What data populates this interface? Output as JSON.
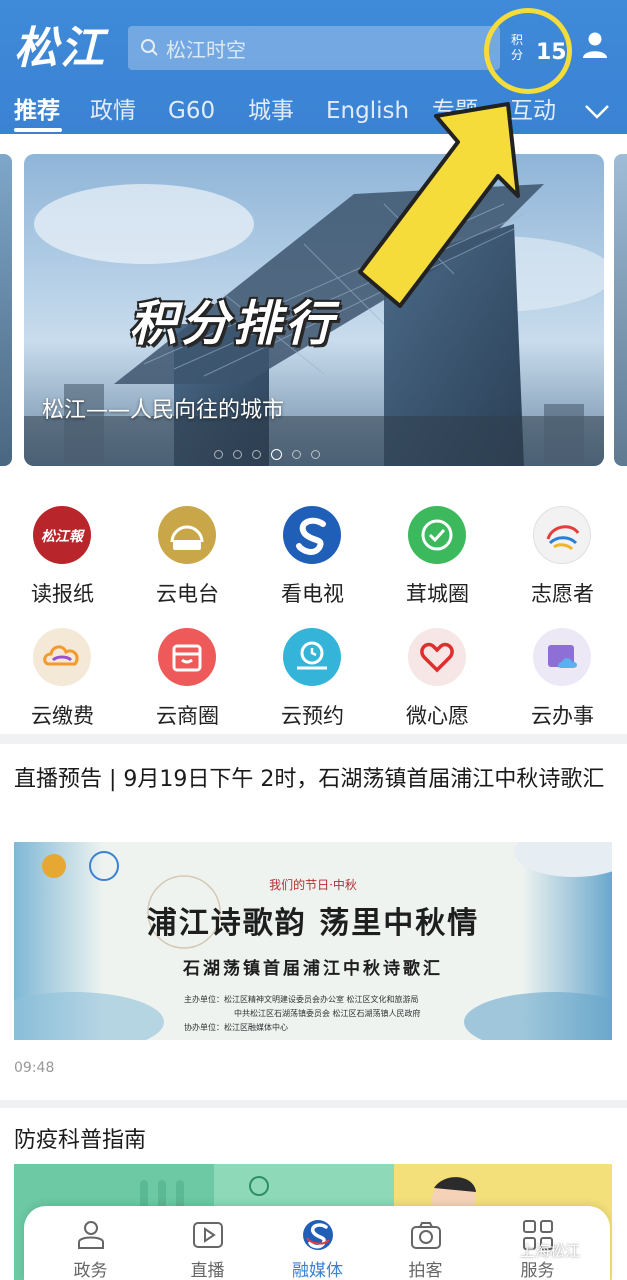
{
  "header": {
    "logo_text": "松江",
    "search_placeholder": "松江时空",
    "points_label": "积分",
    "points_value": "15"
  },
  "tabs": [
    {
      "label": "推荐"
    },
    {
      "label": "政情"
    },
    {
      "label": "G60"
    },
    {
      "label": "城事"
    },
    {
      "label": "English"
    },
    {
      "label": "专题"
    },
    {
      "label": "互动"
    }
  ],
  "banner": {
    "overlay_text": "积分排行",
    "caption": "松江——人民向往的城市",
    "slide_count": 6,
    "active_slide": 4
  },
  "services": [
    {
      "label": "读报纸",
      "icon": "newspaper-icon",
      "color": "#b8262b"
    },
    {
      "label": "云电台",
      "icon": "radio-icon",
      "color": "#c9a648"
    },
    {
      "label": "看电视",
      "icon": "tv-icon",
      "color": "#1f5fb8"
    },
    {
      "label": "茸城圈",
      "icon": "check-badge-icon",
      "color": "#3cb95c"
    },
    {
      "label": "志愿者",
      "icon": "volunteer-icon",
      "color": "#f2f2f2"
    },
    {
      "label": "云缴费",
      "icon": "cloud-pay-icon",
      "color": "#f4e8d6"
    },
    {
      "label": "云商圈",
      "icon": "shop-icon",
      "color": "#ee5a5a"
    },
    {
      "label": "云预约",
      "icon": "appointment-icon",
      "color": "#34b4d8"
    },
    {
      "label": "微心愿",
      "icon": "heart-icon",
      "color": "#f7e6e6"
    },
    {
      "label": "云办事",
      "icon": "cloud-office-icon",
      "color": "#ece8f6"
    }
  ],
  "news": [
    {
      "title": "直播预告 | 9月19日下午 2时，石湖荡镇首届浦江中秋诗歌汇",
      "time": "09:48",
      "poster": {
        "kicker": "我们的节日·中秋",
        "headline": "浦江诗歌韵 荡里中秋情",
        "sub": "石湖荡镇首届浦江中秋诗歌汇",
        "credits": [
          "主办单位：松江区精神文明建设委员会办公室  松江区文化和旅游局",
          "中共松江区石湖荡镇委员会  松江区石湖荡镇人民政府",
          "协办单位：松江区融媒体中心"
        ]
      }
    },
    {
      "title": "防疫科普指南"
    }
  ],
  "bottom_nav": [
    {
      "label": "政务",
      "icon": "gov-icon"
    },
    {
      "label": "直播",
      "icon": "play-icon"
    },
    {
      "label": "融媒体",
      "icon": "media-logo-icon"
    },
    {
      "label": "拍客",
      "icon": "camera-icon"
    },
    {
      "label": "服务",
      "icon": "grid-icon"
    }
  ],
  "watermark": "上海松江",
  "colors": {
    "header_bg": "#3b82d3",
    "accent": "#3b82d3",
    "highlight": "#f5dc3a"
  }
}
